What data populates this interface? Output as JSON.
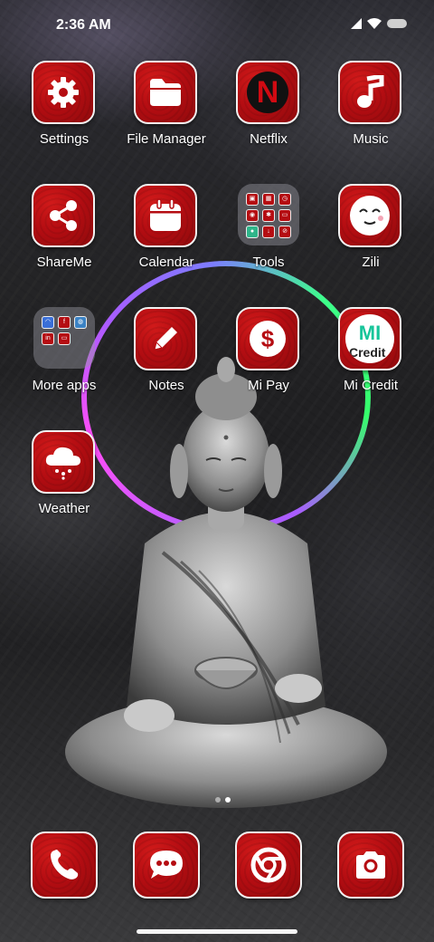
{
  "status": {
    "time": "2:36 AM"
  },
  "apps": [
    {
      "label": "Settings",
      "icon": "gear-icon"
    },
    {
      "label": "File Manager",
      "icon": "folder-icon"
    },
    {
      "label": "Netflix",
      "icon": "netflix-icon"
    },
    {
      "label": "Music",
      "icon": "music-note-icon"
    },
    {
      "label": "ShareMe",
      "icon": "share-icon"
    },
    {
      "label": "Calendar",
      "icon": "calendar-icon"
    },
    {
      "label": "Tools",
      "icon": "folder-icon"
    },
    {
      "label": "Zili",
      "icon": "smiley-face-icon"
    },
    {
      "label": "More apps",
      "icon": "folder-icon"
    },
    {
      "label": "Notes",
      "icon": "pencil-icon"
    },
    {
      "label": "Mi Pay",
      "icon": "dollar-icon"
    },
    {
      "label": "Mi Credit",
      "icon": "mi-credit-icon"
    },
    {
      "label": "Weather",
      "icon": "cloud-rain-icon"
    }
  ],
  "netflix_letter": "N",
  "mi_credit_logo": {
    "line1": "MI",
    "line2": "Credit"
  },
  "dock": [
    {
      "name": "phone",
      "icon": "phone-icon"
    },
    {
      "name": "messages",
      "icon": "chat-bubble-icon"
    },
    {
      "name": "chrome",
      "icon": "chrome-icon"
    },
    {
      "name": "camera",
      "icon": "camera-icon"
    }
  ],
  "page_indicator": {
    "pages": 2,
    "current": 2
  },
  "colors": {
    "tile_red": "#b50d12",
    "halo_purple": "#c05dff",
    "halo_green": "#35ff6b"
  }
}
